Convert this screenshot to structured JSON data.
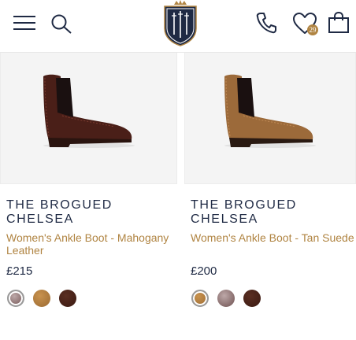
{
  "header": {
    "menu_icon": "hamburger-menu-icon",
    "search_icon": "search-icon",
    "logo_icon": "shield-crest-logo",
    "phone_icon": "phone-icon",
    "wishlist_icon": "heart-icon",
    "wishlist_count": "29",
    "bag_icon": "shopping-bag-icon"
  },
  "products": [
    {
      "title": "THE BROGUED CHELSEA",
      "subtitle": "Women's Ankle Boot - Mahogany Leather",
      "price": "£215",
      "swatches": [
        "dusty-rose",
        "tan",
        "mahogany"
      ],
      "selected": 0,
      "boot_color": "#4a1f18"
    },
    {
      "title": "THE BROGUED CHELSEA",
      "subtitle": "Women's Ankle Boot - Tan Suede",
      "price": "£200",
      "swatches": [
        "tan",
        "dusty-rose",
        "mahogany"
      ],
      "selected": 0,
      "boot_color": "#9c6a3a"
    }
  ],
  "colors": {
    "navy": "#1f2a44",
    "gold": "#b08442"
  }
}
